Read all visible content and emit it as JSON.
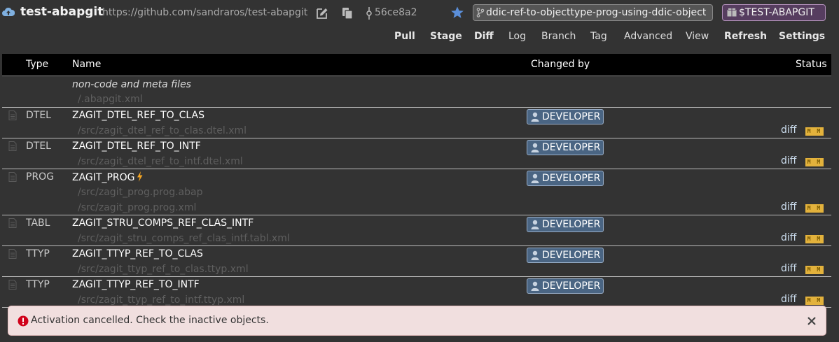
{
  "header": {
    "repo_name": "test-abapgit",
    "repo_url": "https://github.com/sandraros/test-abapgit",
    "commit_hash": "56ce8a2",
    "branch": "ddic-ref-to-objecttype-prog-using-ddic-object",
    "package": "$TEST-ABAPGIT"
  },
  "toolbar": {
    "items": [
      {
        "label": "Pull",
        "bold": true
      },
      {
        "label": "Stage",
        "bold": true
      },
      {
        "label": "Diff",
        "bold": true
      },
      {
        "label": "Log",
        "bold": false
      },
      {
        "label": "Branch",
        "bold": false
      },
      {
        "label": "Tag",
        "bold": false
      },
      {
        "label": "Advanced",
        "bold": false
      },
      {
        "label": "View",
        "bold": false
      },
      {
        "label": "Refresh",
        "bold": true
      },
      {
        "label": "Settings",
        "bold": true
      }
    ]
  },
  "table": {
    "columns": {
      "type": "Type",
      "name": "Name",
      "changed_by": "Changed by",
      "status": "Status"
    },
    "meta_group": {
      "label": "non-code and meta files",
      "file": "/.abapgit.xml"
    },
    "rows": [
      {
        "type": "DTEL",
        "name": "ZAGIT_DTEL_REF_TO_CLAS",
        "files": [
          "/src/zagit_dtel_ref_to_clas.dtel.xml"
        ],
        "changed_by": "DEVELOPER",
        "diff": "diff",
        "status": "M M"
      },
      {
        "type": "DTEL",
        "name": "ZAGIT_DTEL_REF_TO_INTF",
        "files": [
          "/src/zagit_dtel_ref_to_intf.dtel.xml"
        ],
        "changed_by": "DEVELOPER",
        "diff": "diff",
        "status": "M M"
      },
      {
        "type": "PROG",
        "name": "ZAGIT_PROG",
        "inactive": true,
        "files": [
          "/src/zagit_prog.prog.abap",
          "/src/zagit_prog.prog.xml"
        ],
        "changed_by": "DEVELOPER",
        "diff": "diff",
        "status": "M M"
      },
      {
        "type": "TABL",
        "name": "ZAGIT_STRU_COMPS_REF_CLAS_INTF",
        "files": [
          "/src/zagit_stru_comps_ref_clas_intf.tabl.xml"
        ],
        "changed_by": "DEVELOPER",
        "diff": "diff",
        "status": "M M"
      },
      {
        "type": "TTYP",
        "name": "ZAGIT_TTYP_REF_TO_CLAS",
        "files": [
          "/src/zagit_ttyp_ref_to_clas.ttyp.xml"
        ],
        "changed_by": "DEVELOPER",
        "diff": "diff",
        "status": "M M"
      },
      {
        "type": "TTYP",
        "name": "ZAGIT_TTYP_REF_TO_INTF",
        "files": [
          "/src/zagit_ttyp_ref_to_intf.ttyp.xml"
        ],
        "changed_by": "DEVELOPER",
        "diff": "diff",
        "status": "M M"
      }
    ]
  },
  "toast": {
    "message": "Activation cancelled. Check the inactive objects."
  },
  "colors": {
    "background": "#333333",
    "header_row": "#000000",
    "user_badge": "#4a6583",
    "status_badge": "#e3b23c",
    "package_badge": "#563d5f",
    "toast_bg": "#f1dfdf",
    "error_icon": "#d0021b"
  },
  "icons": {
    "repo": "cloud-upload-icon",
    "edit": "edit-icon",
    "copy": "copy-icon",
    "commit": "commit-icon",
    "favorite": "star-icon",
    "branch": "branch-icon",
    "package": "package-icon",
    "file": "file-icon",
    "user": "user-icon",
    "inactive": "flash-icon",
    "error": "error-icon",
    "close": "close-icon"
  }
}
